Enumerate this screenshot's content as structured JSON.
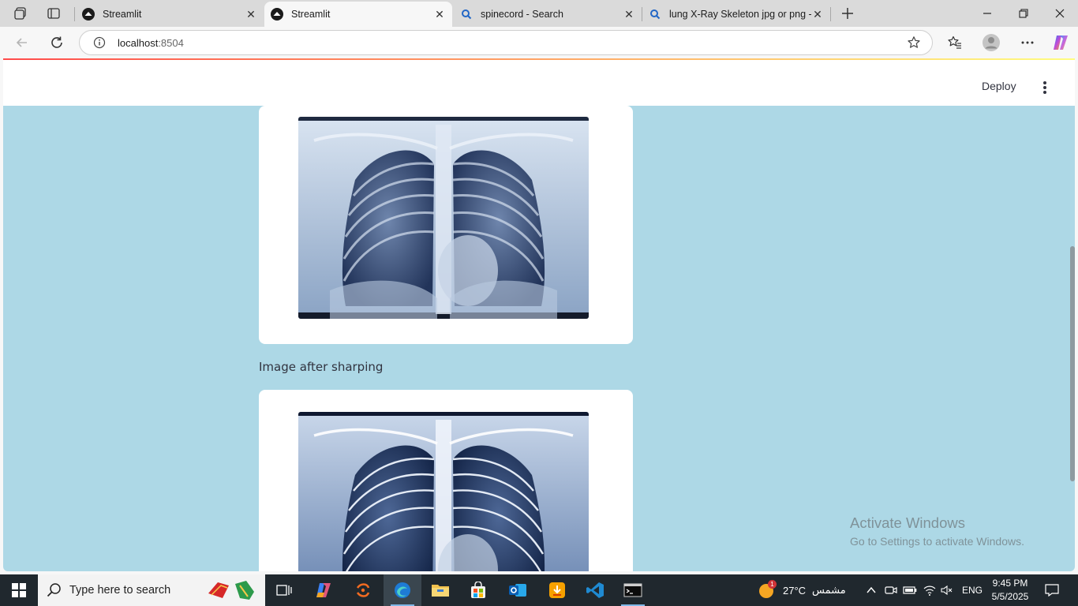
{
  "browser": {
    "tabs": [
      {
        "title": "Streamlit",
        "active": false
      },
      {
        "title": "Streamlit",
        "active": true
      },
      {
        "title": "spinecord - Search",
        "active": false
      },
      {
        "title": "lung X-Ray Skeleton jpg or png -",
        "active": false
      }
    ],
    "url_host": "localhost",
    "url_port": ":8504"
  },
  "header": {
    "deploy_label": "Deploy"
  },
  "main": {
    "caption": "Image after sharping"
  },
  "watermark": {
    "line1": "Activate Windows",
    "line2": "Go to Settings to activate Windows."
  },
  "taskbar": {
    "search_placeholder": "Type here to search",
    "weather_temp": "27°C",
    "weather_text": "مشمس",
    "weather_badge": "1",
    "language": "ENG",
    "time": "9:45 PM",
    "date": "5/5/2025"
  },
  "colors": {
    "page_background": "#add8e6",
    "card_background": "#ffffff",
    "text": "#31333f",
    "taskbar": "#20282e"
  }
}
